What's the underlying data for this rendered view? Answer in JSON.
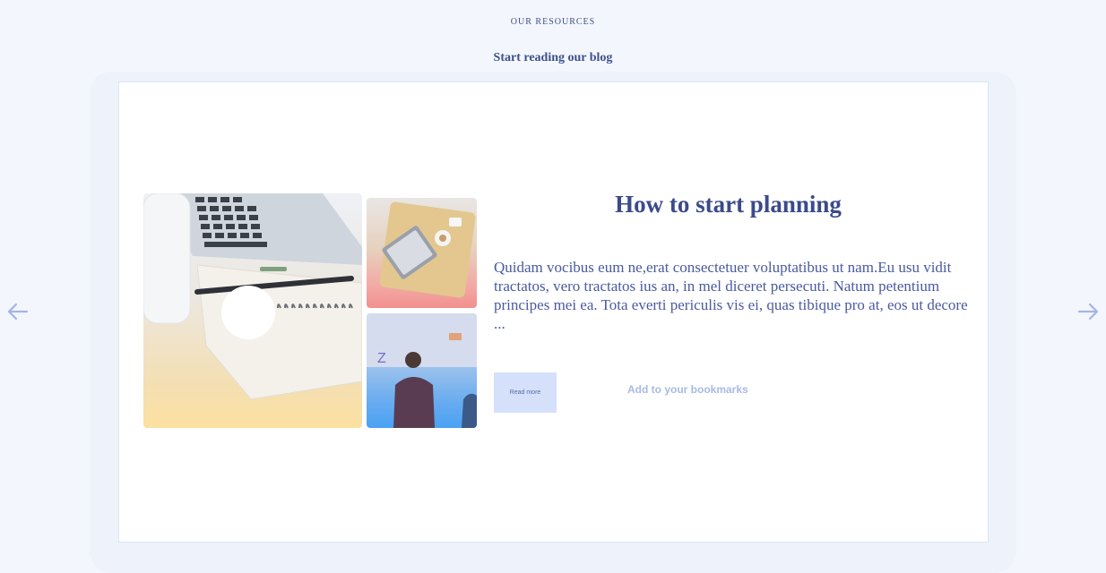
{
  "header": {
    "section_label": "OUR RESOURCES",
    "section_title": "Start reading our blog"
  },
  "carousel": {
    "prev_icon": "arrow-left-icon",
    "next_icon": "arrow-right-icon",
    "arrow_color": "#a6b3e8"
  },
  "post": {
    "title": "How to start planning",
    "excerpt": "Quidam vocibus eum ne,erat consectetuer voluptatibus ut nam.Eu usu vidit tractatos, vero tractatos ius an, in mel diceret persecuti. Natum petentium principes mei ea. Tota everti periculis vis ei, quas tibique pro at, eos ut decore ...",
    "read_more_label": "Read more",
    "bookmark_label": "Add to your bookmarks",
    "images": {
      "main": "laptop-notebook-desk-photo",
      "top": "laptop-on-tray-photo",
      "bottom": "people-at-whiteboard-photo"
    }
  },
  "colors": {
    "heading": "#3a4a8c",
    "accent": "#d5e0fb",
    "background": "#f3f7fd"
  }
}
